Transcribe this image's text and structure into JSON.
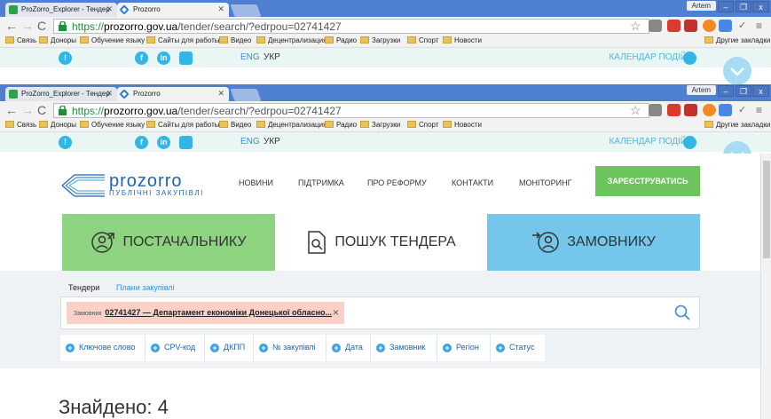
{
  "browser_back": {
    "tabs": [
      "ProZorro_Explorer - Тендер",
      "Prozorro"
    ],
    "user": "Artem",
    "url_https": "https://",
    "url_host": "prozorro.gov.ua",
    "url_path": "/tender/search/?edrpou=02741427",
    "bookmarks": [
      "Связь",
      "Доноры",
      "Обучение языку",
      "Сайты для работы",
      "Видео",
      "Децентрализация",
      "Радио",
      "Загрузки",
      "Спорт",
      "Новости"
    ],
    "other_bookmarks": "Другие закладки"
  },
  "browser_front": {
    "tabs": [
      "ProZorro_Explorer - Тендер",
      "Prozorro"
    ],
    "user": "Artem",
    "url_https": "https://",
    "url_host": "prozorro.gov.ua",
    "url_path": "/tender/search/?edrpou=02741427",
    "bookmarks": [
      "Связь",
      "Доноры",
      "Обучение языку",
      "Сайты для работы",
      "Видео",
      "Децентрализация",
      "Радио",
      "Загрузки",
      "Спорт",
      "Новости"
    ],
    "other_bookmarks": "Другие закладки"
  },
  "window_controls": [
    "–",
    "❐",
    "x"
  ],
  "topbar": {
    "lang_en": "ENG",
    "lang_ua": "УКР",
    "calendar": "КАЛЕНДАР ПОДІЙ",
    "info": "!",
    "fb": "f",
    "in": "in"
  },
  "logo": {
    "word": "prozorro",
    "sub": "ПУБЛІЧНІ ЗАКУПІВЛІ"
  },
  "menu": [
    "НОВИНИ",
    "ПІДТРИМКА",
    "ПРО РЕФОРМУ",
    "КОНТАКТИ",
    "МОНІТОРИНГ"
  ],
  "register": "ЗАРЕЄСТРУВАТИСЬ",
  "roles": {
    "supplier": "ПОСТАЧАЛЬНИКУ",
    "search": "ПОШУК ТЕНДЕРА",
    "customer": "ЗАМОВНИКУ"
  },
  "subtabs": {
    "tenders": "Тендери",
    "plans": "Плани закупівлі"
  },
  "chip": {
    "label": "Замовник",
    "value": "02741427 — Департамент економіки Донецької обласно...",
    "close": "×"
  },
  "filters": [
    "Ключове слово",
    "CPV-код",
    "ДКПП",
    "№ закупівлі",
    "Дата",
    "Замовник",
    "Регіон",
    "Статус"
  ],
  "found": "Знайдено: 4",
  "colors": {
    "chrome_blue": "#4f7fd0",
    "supplier_green": "#8ed37f",
    "customer_blue": "#74c6ea",
    "register_green": "#6cc45c",
    "chip_bg": "#fbd0c7"
  }
}
